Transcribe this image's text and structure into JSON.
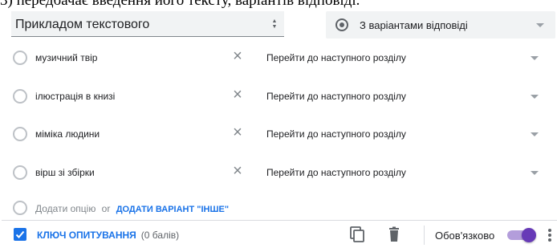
{
  "caption": "3) передбачає введення його тексту, варіантів відповіді.",
  "question": {
    "title": "Прикладом текстового"
  },
  "type_select": {
    "label": "З варіантами відповіді",
    "icon": "radio-button-checked-icon"
  },
  "options": [
    {
      "label": "музичний твір",
      "goto": "Перейти до наступного розділу"
    },
    {
      "label": "ілюстрація в книзі",
      "goto": "Перейти до наступного розділу"
    },
    {
      "label": "міміка людини",
      "goto": "Перейти до наступного розділу"
    },
    {
      "label": "вірш зі збірки",
      "goto": "Перейти до наступного розділу"
    }
  ],
  "add_row": {
    "add_option": "Додати опцію",
    "or": "or",
    "add_other": "ДОДАТИ ВАРІАНТ \"ІНШЕ\""
  },
  "footer": {
    "answer_key": "КЛЮЧ ОПИТУВАННЯ",
    "points": "(0 балів)",
    "required": "Обов'язково",
    "required_on": true
  },
  "colors": {
    "accent_blue": "#1a73e8",
    "toggle_purple": "#673ab7",
    "field_bg": "#f1f3f4"
  }
}
